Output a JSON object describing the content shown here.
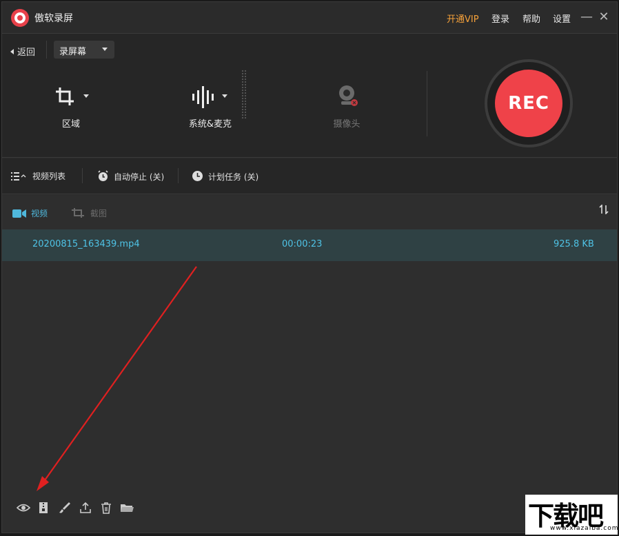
{
  "app": {
    "title": "傲软录屏"
  },
  "title_menu": {
    "vip": "开通VIP",
    "login": "登录",
    "help": "帮助",
    "settings": "设置"
  },
  "window_buttons": {
    "minimize": "—",
    "close": "✕"
  },
  "toolbar": {
    "back": "返回",
    "mode": "录屏幕",
    "region": "区域",
    "audio": "系统&麦克",
    "camera": "摄像头",
    "rec": "REC"
  },
  "options": {
    "video_list": "视频列表",
    "auto_stop": "自动停止 (关)",
    "schedule": "计划任务 (关)"
  },
  "tabs": {
    "video": "视频",
    "screenshot": "截图"
  },
  "files": [
    {
      "name": "20200815_163439.mp4",
      "duration": "00:00:23",
      "size": "925.8 KB"
    }
  ],
  "colors": {
    "accent": "#4fc3e6",
    "rec": "#ef4249",
    "vip": "#f7a23a",
    "selected_row": "#2f4144"
  },
  "bottom_icons": [
    "eye-icon",
    "zip-icon",
    "brush-icon",
    "upload-icon",
    "trash-icon",
    "folder-icon"
  ],
  "watermark": {
    "main": "下载吧",
    "sub": "www.xiazaiba.com"
  }
}
